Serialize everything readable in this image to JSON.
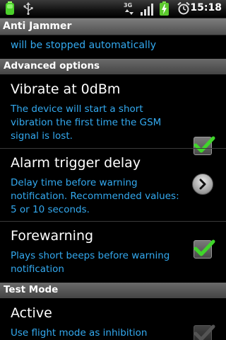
{
  "status_bar": {
    "time": "15:18",
    "icons": [
      "battery-level-icon",
      "usb-icon",
      "3g-icon",
      "signal-icon",
      "charging-battery-icon",
      "alarm-clock-icon"
    ]
  },
  "app": {
    "title": "Anti Jammer"
  },
  "cut_off_item": {
    "summary": "will be stopped automatically"
  },
  "sections": {
    "advanced": "Advanced options",
    "test_mode": "Test Mode"
  },
  "preferences": {
    "vibrate": {
      "title": "Vibrate at 0dBm",
      "summary": "The device will start a short vibration the first time the GSM signal is lost.",
      "checked": true
    },
    "alarm_delay": {
      "title": "Alarm trigger delay",
      "summary": "Delay time before warning notification. Recommended values: 5 or 10 seconds."
    },
    "forewarning": {
      "title": "Forewarning",
      "summary": "Plays short beeps before warning notification",
      "checked": true
    },
    "active": {
      "title": "Active",
      "summary": "Use flight mode as inhibition",
      "checked": true,
      "enabled": false
    }
  },
  "colors": {
    "summary": "#33a9ef",
    "check": "#3fd52a",
    "header": "#555555"
  }
}
